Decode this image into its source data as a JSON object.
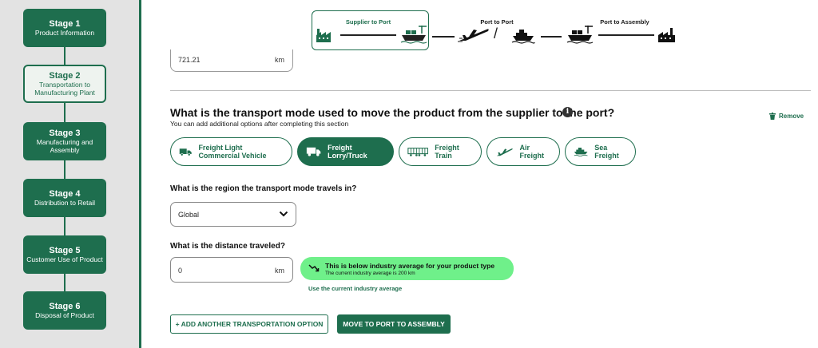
{
  "sidebar": {
    "stages": [
      {
        "title": "Stage 1",
        "desc": "Product Information",
        "active": false
      },
      {
        "title": "Stage 2",
        "desc": "Transportation to Manufacturing Plant",
        "active": true
      },
      {
        "title": "Stage 3",
        "desc": "Manufacturing and Assembly",
        "active": false
      },
      {
        "title": "Stage 4",
        "desc": "Distribution to Retail",
        "active": false
      },
      {
        "title": "Stage 5",
        "desc": "Customer Use of Product",
        "active": false
      },
      {
        "title": "Stage 6",
        "desc": "Disposal of Product",
        "active": false
      }
    ]
  },
  "route": {
    "supplier_to_port": "Supplier to Port",
    "port_to_port": "Port to Port",
    "port_to_assembly": "Port to Assembly",
    "slash": "/"
  },
  "previous": {
    "distance_value": "721.21",
    "unit": "km"
  },
  "question": {
    "title": "What is the transport mode used to move the product from the supplier to the port?",
    "subtitle": "You can add additional options after completing this section",
    "remove_label": "Remove"
  },
  "modes": [
    {
      "label": "Freight Light Commercial Vehicle",
      "icon": "van-icon",
      "selected": false
    },
    {
      "label": "Freight Lorry/Truck",
      "icon": "truck-icon",
      "selected": true
    },
    {
      "label": "Freight Train",
      "icon": "train-icon",
      "selected": false
    },
    {
      "label": "Air Freight",
      "icon": "plane-icon",
      "selected": false
    },
    {
      "label": "Sea Freight",
      "icon": "ship-icon",
      "selected": false
    }
  ],
  "region": {
    "label": "What is the region the transport mode travels in?",
    "selected": "Global"
  },
  "distance": {
    "label": "What is the distance traveled?",
    "value": "0",
    "unit": "km",
    "badge_title": "This is below industry average for your product type",
    "badge_sub": "The current industry average is 200 km",
    "use_average": "Use the current industry average"
  },
  "actions": {
    "add_option": "+ ADD ANOTHER TRANSPORTATION OPTION",
    "next": "MOVE TO PORT TO ASSEMBLY"
  },
  "colors": {
    "brand_green": "#1e6e4e",
    "badge_green": "#6ff08a",
    "sidebar_bg": "#e3e3e3"
  }
}
